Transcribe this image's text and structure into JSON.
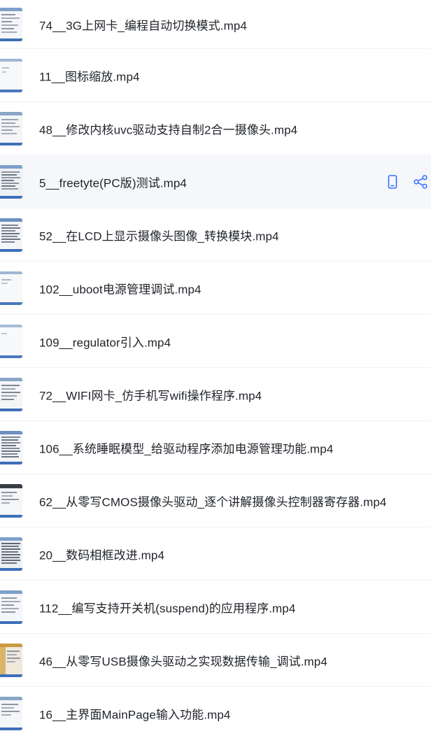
{
  "files": [
    {
      "name": "74__3G上网卡_编程自动切换模式.mp4"
    },
    {
      "name": "11__图标缩放.mp4"
    },
    {
      "name": "48__修改内核uvc驱动支持自制2合一摄像头.mp4"
    },
    {
      "name": "5__freetyte(PC版)测试.mp4"
    },
    {
      "name": "52__在LCD上显示摄像头图像_转换模块.mp4"
    },
    {
      "name": "102__uboot电源管理调试.mp4"
    },
    {
      "name": "109__regulator引入.mp4"
    },
    {
      "name": "72__WIFI网卡_仿手机写wifi操作程序.mp4"
    },
    {
      "name": "106__系统睡眠模型_给驱动程序添加电源管理功能.mp4"
    },
    {
      "name": "62__从零写CMOS摄像头驱动_逐个讲解摄像头控制器寄存器.mp4"
    },
    {
      "name": "20__数码相框改进.mp4"
    },
    {
      "name": "112__编写支持开关机(suspend)的应用程序.mp4"
    },
    {
      "name": "46__从零写USB摄像头驱动之实现数据传输_调试.mp4"
    },
    {
      "name": "16__主界面MainPage输入功能.mp4"
    }
  ],
  "hovered_actions": {
    "icons": [
      "mobile-phone-icon",
      "share-icon"
    ]
  },
  "colors": {
    "text": "#1f2329",
    "accent": "#3370ff",
    "hover_background": "#f5f7fb",
    "divider": "#f1f2f4"
  }
}
